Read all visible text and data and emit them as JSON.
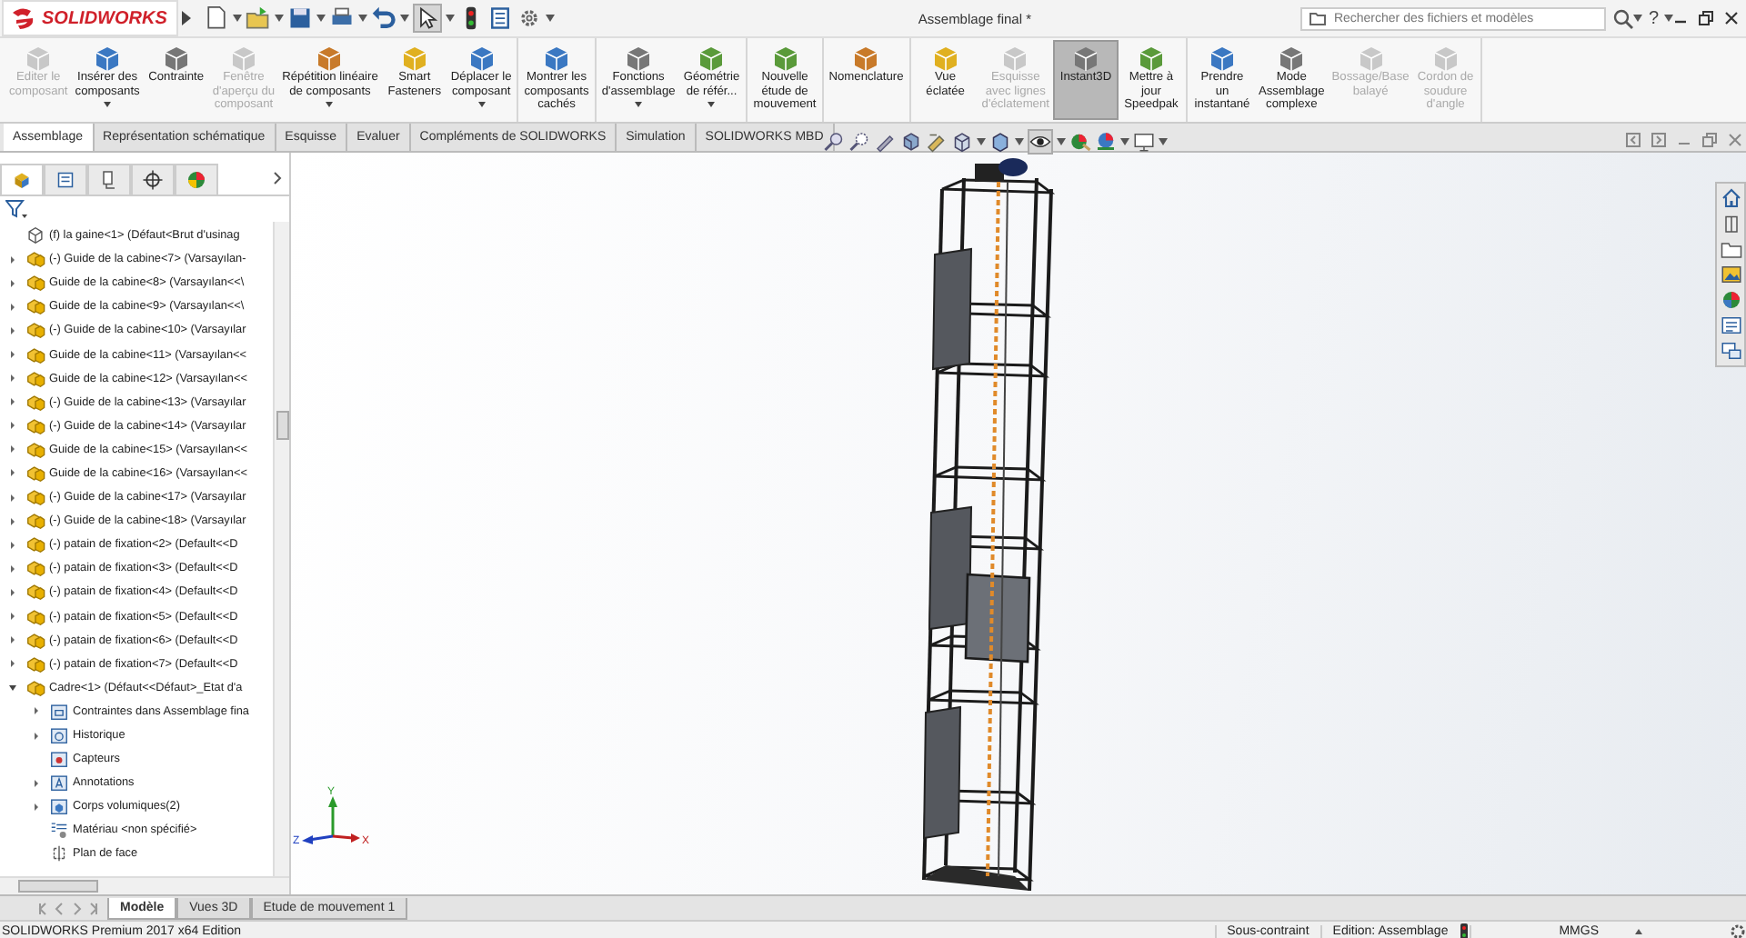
{
  "title_bar": {
    "app": "SOLIDWORKS",
    "title": "Assemblage final *",
    "search_placeholder": "Rechercher des fichiers et modèles",
    "help": "?"
  },
  "ribbon": {
    "groups": [
      {
        "items": [
          {
            "label": "Editer le\ncomposant",
            "disabled": true,
            "selected": false,
            "dropdown": false
          },
          {
            "label": "Insérer des\ncomposants",
            "disabled": false,
            "selected": false,
            "dropdown": true
          },
          {
            "label": "Contrainte",
            "disabled": false,
            "selected": false,
            "dropdown": false
          },
          {
            "label": "Fenêtre\nd'aperçu du\ncomposant",
            "disabled": true,
            "selected": false,
            "dropdown": false
          },
          {
            "label": "Répétition linéaire\nde composants",
            "disabled": false,
            "selected": false,
            "dropdown": true
          },
          {
            "label": "Smart\nFasteners",
            "disabled": false,
            "selected": false,
            "dropdown": false
          },
          {
            "label": "Déplacer le\ncomposant",
            "disabled": false,
            "selected": false,
            "dropdown": true
          }
        ]
      },
      {
        "items": [
          {
            "label": "Montrer les\ncomposants\ncachés",
            "disabled": false,
            "selected": false,
            "dropdown": false
          }
        ]
      },
      {
        "items": [
          {
            "label": "Fonctions\nd'assemblage",
            "disabled": false,
            "selected": false,
            "dropdown": true
          },
          {
            "label": "Géométrie\nde référ...",
            "disabled": false,
            "selected": false,
            "dropdown": true
          }
        ]
      },
      {
        "items": [
          {
            "label": "Nouvelle\nétude de\nmouvement",
            "disabled": false,
            "selected": false,
            "dropdown": false
          }
        ]
      },
      {
        "items": [
          {
            "label": "Nomenclature",
            "disabled": false,
            "selected": false,
            "dropdown": false
          }
        ]
      },
      {
        "items": [
          {
            "label": "Vue\néclatée",
            "disabled": false,
            "selected": false,
            "dropdown": false
          },
          {
            "label": "Esquisse\navec lignes\nd'éclatement",
            "disabled": true,
            "selected": false,
            "dropdown": false
          },
          {
            "label": "Instant3D",
            "disabled": false,
            "selected": true,
            "dropdown": false
          },
          {
            "label": "Mettre à\njour\nSpeedpak",
            "disabled": false,
            "selected": false,
            "dropdown": false
          }
        ]
      },
      {
        "items": [
          {
            "label": "Prendre\nun\ninstantané",
            "disabled": false,
            "selected": false,
            "dropdown": false
          },
          {
            "label": "Mode\nAssemblage\ncomplexe",
            "disabled": false,
            "selected": false,
            "dropdown": false
          },
          {
            "label": "Bossage/Base\nbalayé",
            "disabled": true,
            "selected": false,
            "dropdown": false
          },
          {
            "label": "Cordon de\nsoudure\nd'angle",
            "disabled": true,
            "selected": false,
            "dropdown": false
          }
        ]
      }
    ]
  },
  "command_tabs": [
    {
      "label": "Assemblage",
      "selected": true
    },
    {
      "label": "Représentation schématique",
      "selected": false
    },
    {
      "label": "Esquisse",
      "selected": false
    },
    {
      "label": "Evaluer",
      "selected": false
    },
    {
      "label": "Compléments de SOLIDWORKS",
      "selected": false
    },
    {
      "label": "Simulation",
      "selected": false
    },
    {
      "label": "SOLIDWORKS MBD",
      "selected": false
    }
  ],
  "panel_tabs": [
    {
      "selected": true
    },
    {
      "selected": false
    },
    {
      "selected": false
    },
    {
      "selected": false
    },
    {
      "selected": false
    }
  ],
  "feature_tree": {
    "items": [
      {
        "text": "(f) la gaine<1> (Défaut<Brut d'usinag",
        "kind": "part"
      },
      {
        "text": "(-) Guide de la cabine<7> (Varsayılan-",
        "kind": "assembly",
        "expanded": false
      },
      {
        "text": "Guide de la cabine<8> (Varsayılan<<\\",
        "kind": "assembly",
        "expanded": false
      },
      {
        "text": "Guide de la cabine<9> (Varsayılan<<\\",
        "kind": "assembly",
        "expanded": false
      },
      {
        "text": "(-) Guide de la cabine<10> (Varsayılar",
        "kind": "assembly",
        "expanded": false
      },
      {
        "text": "Guide de la cabine<11> (Varsayılan<<",
        "kind": "assembly",
        "expanded": false
      },
      {
        "text": "Guide de la cabine<12> (Varsayılan<<",
        "kind": "assembly",
        "expanded": false
      },
      {
        "text": "(-) Guide de la cabine<13> (Varsayılar",
        "kind": "assembly",
        "expanded": false
      },
      {
        "text": "(-) Guide de la cabine<14> (Varsayılar",
        "kind": "assembly",
        "expanded": false
      },
      {
        "text": "Guide de la cabine<15> (Varsayılan<<",
        "kind": "assembly",
        "expanded": false
      },
      {
        "text": "Guide de la cabine<16> (Varsayılan<<",
        "kind": "assembly",
        "expanded": false
      },
      {
        "text": "(-) Guide de la cabine<17> (Varsayılar",
        "kind": "assembly",
        "expanded": false
      },
      {
        "text": "(-) Guide de la cabine<18> (Varsayılar",
        "kind": "assembly",
        "expanded": false
      },
      {
        "text": "(-) patain de fixation<2> (Default<<D",
        "kind": "assembly",
        "expanded": false
      },
      {
        "text": "(-) patain de fixation<3> (Default<<D",
        "kind": "assembly",
        "expanded": false
      },
      {
        "text": "(-) patain de fixation<4> (Default<<D",
        "kind": "assembly",
        "expanded": false
      },
      {
        "text": "(-) patain de fixation<5> (Default<<D",
        "kind": "assembly",
        "expanded": false
      },
      {
        "text": "(-) patain de fixation<6> (Default<<D",
        "kind": "assembly",
        "expanded": false
      },
      {
        "text": "(-) patain de fixation<7> (Default<<D",
        "kind": "assembly",
        "expanded": false
      },
      {
        "text": "Cadre<1> (Défaut<<Défaut>_Etat d'a",
        "kind": "assembly",
        "expanded": true,
        "children": [
          {
            "text": "Contraintes dans Assemblage fina",
            "kind": "mates",
            "expanded": false
          },
          {
            "text": "Historique",
            "kind": "history",
            "expanded": false
          },
          {
            "text": "Capteurs",
            "kind": "sensors"
          },
          {
            "text": "Annotations",
            "kind": "annotations",
            "expanded": false
          },
          {
            "text": "Corps volumiques(2)",
            "kind": "bodies",
            "expanded": false
          },
          {
            "text": "Matériau <non spécifié>",
            "kind": "material"
          },
          {
            "text": "Plan de face",
            "kind": "plane"
          }
        ]
      }
    ]
  },
  "triad": {
    "y": "Y",
    "z": "Z",
    "x": "X"
  },
  "bottom_tabs": [
    {
      "label": "Modèle",
      "selected": true
    },
    {
      "label": "Vues 3D",
      "selected": false
    },
    {
      "label": "Etude de mouvement 1",
      "selected": false
    }
  ],
  "status_bar": {
    "edition": "SOLIDWORKS Premium 2017 x64 Edition",
    "fields": [
      "Sous-contraint",
      "Edition: Assemblage",
      "MMGS"
    ]
  }
}
